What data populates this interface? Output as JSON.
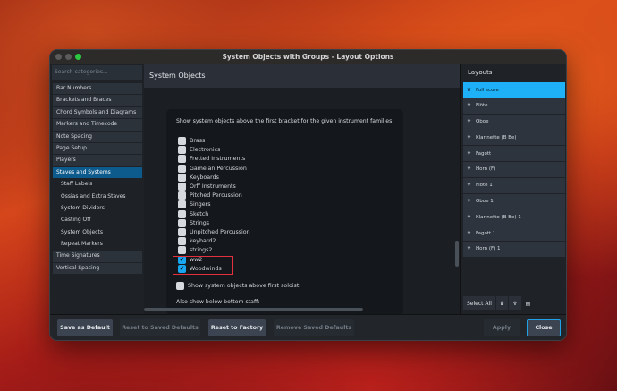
{
  "window": {
    "title": "System Objects with Groups - Layout Options"
  },
  "sidebar": {
    "search_placeholder": "Search categories...",
    "items": [
      {
        "label": "Bar Numbers",
        "sub": false
      },
      {
        "label": "Brackets and Braces",
        "sub": false
      },
      {
        "label": "Chord Symbols and Diagrams",
        "sub": false
      },
      {
        "label": "Markers and Timecode",
        "sub": false
      },
      {
        "label": "Note Spacing",
        "sub": false
      },
      {
        "label": "Page Setup",
        "sub": false
      },
      {
        "label": "Players",
        "sub": false
      },
      {
        "label": "Staves and Systems",
        "sub": false,
        "selected": true
      },
      {
        "label": "Staff Labels",
        "sub": true
      },
      {
        "label": "Ossias and Extra Staves",
        "sub": true
      },
      {
        "label": "System Dividers",
        "sub": true
      },
      {
        "label": "Casting Off",
        "sub": true
      },
      {
        "label": "System Objects",
        "sub": true
      },
      {
        "label": "Repeat Markers",
        "sub": true
      },
      {
        "label": "Time Signatures",
        "sub": false
      },
      {
        "label": "Vertical Spacing",
        "sub": false
      }
    ]
  },
  "main": {
    "title": "System Objects",
    "description": "Show system objects above the first bracket for the given instrument families:",
    "families": [
      {
        "label": "Brass",
        "checked": false
      },
      {
        "label": "Electronics",
        "checked": false
      },
      {
        "label": "Fretted Instruments",
        "checked": false
      },
      {
        "label": "Gamelan Percussion",
        "checked": false
      },
      {
        "label": "Keyboards",
        "checked": false
      },
      {
        "label": "Orff Instruments",
        "checked": false
      },
      {
        "label": "Pitched Percussion",
        "checked": false
      },
      {
        "label": "Singers",
        "checked": false
      },
      {
        "label": "Sketch",
        "checked": false
      },
      {
        "label": "Strings",
        "checked": false
      },
      {
        "label": "Unpitched Percussion",
        "checked": false
      },
      {
        "label": "keybard2",
        "checked": false
      },
      {
        "label": "strings2",
        "checked": false
      },
      {
        "label": "ww2",
        "checked": true
      },
      {
        "label": "Woodwinds",
        "checked": true
      }
    ],
    "soloist": {
      "label": "Show system objects above first soloist",
      "checked": false
    },
    "also_label": "Also show below bottom staff:"
  },
  "layouts": {
    "title": "Layouts",
    "items": [
      {
        "label": "Full score",
        "type": "full-score",
        "selected": true
      },
      {
        "label": "Flöte",
        "type": "part"
      },
      {
        "label": "Oboe",
        "type": "part"
      },
      {
        "label": "Klarinette (B Be)",
        "type": "part"
      },
      {
        "label": "Fagott",
        "type": "part"
      },
      {
        "label": "Horn (F)",
        "type": "part"
      },
      {
        "label": "Flöte 1",
        "type": "part"
      },
      {
        "label": "Oboe 1",
        "type": "part"
      },
      {
        "label": "Klarinette (B Be) 1",
        "type": "part"
      },
      {
        "label": "Fagott 1",
        "type": "part"
      },
      {
        "label": "Horn (F) 1",
        "type": "part"
      }
    ],
    "select_all": "Select All"
  },
  "footer": {
    "save_default": "Save as Default",
    "reset_saved": "Reset to Saved Defaults",
    "reset_factory": "Reset to Factory",
    "remove_saved": "Remove Saved Defaults",
    "apply": "Apply",
    "close": "Close"
  },
  "colors": {
    "accent": "#1fb1f7",
    "highlight": "#e2303c",
    "selected_category": "#0d5a8c"
  }
}
